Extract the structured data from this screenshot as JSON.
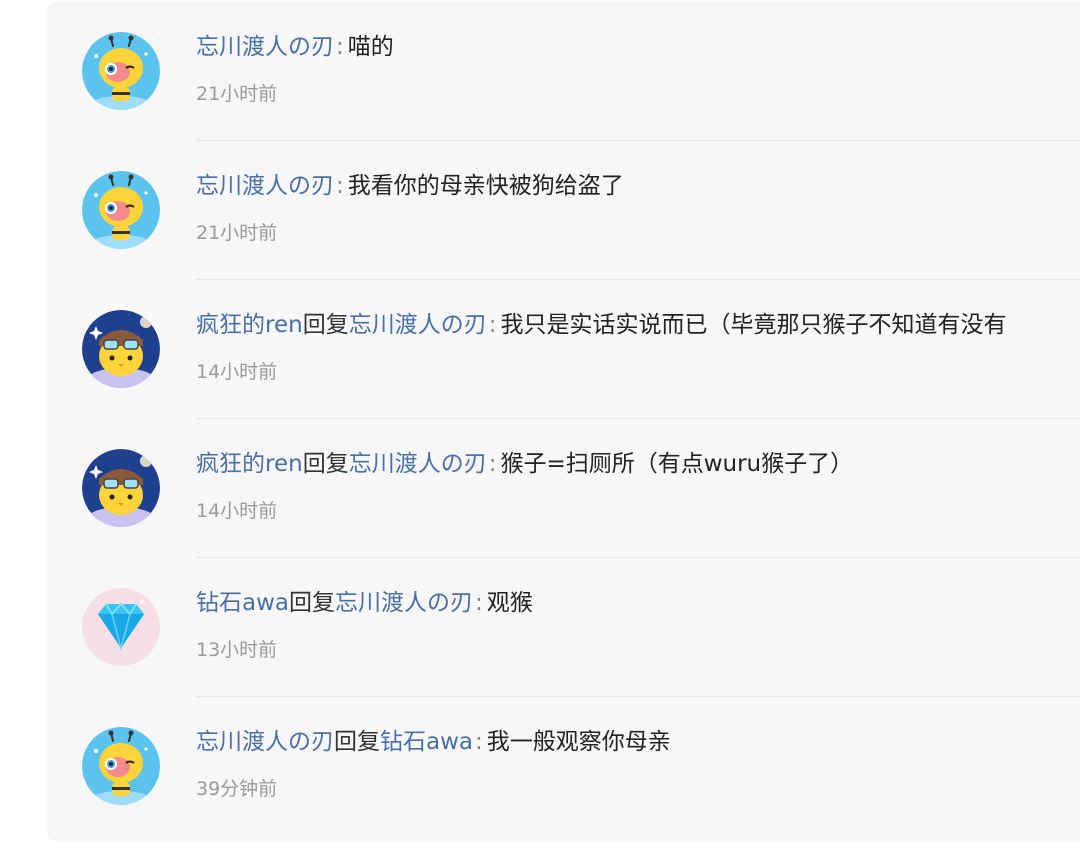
{
  "comments": [
    {
      "author": "忘川渡人の刃",
      "reply_word": "",
      "reply_to": "",
      "colon": ":",
      "message": "喵的",
      "time": "21小时前",
      "avatar": "bee-avatar"
    },
    {
      "author": "忘川渡人の刃",
      "reply_word": "",
      "reply_to": "",
      "colon": ":",
      "message": "我看你的母亲快被狗给盗了",
      "time": "21小时前",
      "avatar": "bee-avatar"
    },
    {
      "author": "疯狂的ren",
      "reply_word": "回复",
      "reply_to": "忘川渡人の刃",
      "colon": ":",
      "message": "我只是实话实说而已（毕竟那只猴子不知道有没有",
      "time": "14小时前",
      "avatar": "pilot-chick-avatar"
    },
    {
      "author": "疯狂的ren",
      "reply_word": "回复",
      "reply_to": "忘川渡人の刃",
      "colon": ":",
      "message": "猴子=扫厕所（有点wuru猴子了）",
      "time": "14小时前",
      "avatar": "pilot-chick-avatar"
    },
    {
      "author": "钻石awa",
      "reply_word": "回复",
      "reply_to": "忘川渡人の刃",
      "colon": ":",
      "message": "观猴",
      "time": "13小时前",
      "avatar": "diamond-avatar"
    },
    {
      "author": "忘川渡人の刃",
      "reply_word": "回复",
      "reply_to": "钻石awa",
      "colon": ":",
      "message": "我一般观察你母亲",
      "time": "39分钟前",
      "avatar": "bee-avatar"
    }
  ]
}
